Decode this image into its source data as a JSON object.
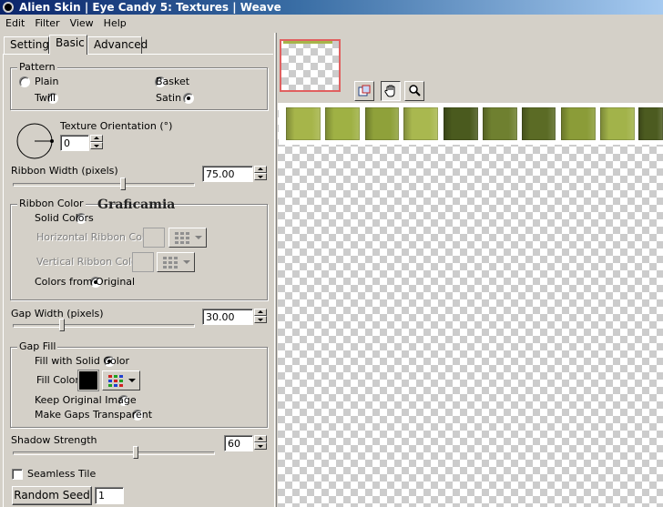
{
  "window": {
    "title": "Alien Skin | Eye Candy 5: Textures | Weave"
  },
  "menu": [
    "Edit",
    "Filter",
    "View",
    "Help"
  ],
  "tabs": [
    "Settings",
    "Basic",
    "Advanced"
  ],
  "active_tab": "Basic",
  "pattern": {
    "title": "Pattern",
    "options": [
      "Plain",
      "Basket",
      "Twill",
      "Satin"
    ],
    "selected": "Satin"
  },
  "texture_orientation": {
    "label": "Texture Orientation (°)",
    "value": "0"
  },
  "ribbon_width": {
    "label": "Ribbon Width (pixels)",
    "value": "75.00",
    "slider_fraction": 0.6
  },
  "ribbon_color": {
    "title": "Ribbon Color",
    "solid_colors": "Solid Colors",
    "horizontal_label": "Horizontal Ribbon Color",
    "vertical_label": "Vertical Ribbon Color",
    "from_original": "Colors from Original",
    "selected": "Colors from Original"
  },
  "watermark": "Graficamia",
  "gap_width": {
    "label": "Gap Width (pixels)",
    "value": "30.00",
    "slider_fraction": 0.27
  },
  "gap_fill": {
    "title": "Gap Fill",
    "fill_solid": "Fill with Solid Color",
    "fill_color_label": "Fill Color",
    "fill_color": "#000000",
    "keep_original": "Keep Original Image",
    "transparent": "Make Gaps Transparent",
    "selected": "Fill with Solid Color"
  },
  "shadow_strength": {
    "label": "Shadow Strength",
    "value": "60",
    "slider_fraction": 0.6
  },
  "seamless_tile": {
    "label": "Seamless Tile",
    "checked": false
  },
  "random_seed": {
    "button": "Random Seed",
    "value": "1"
  },
  "preview": {
    "tools": [
      "navigator-icon",
      "hand-icon",
      "zoom-icon"
    ],
    "tile_colors": [
      "#a6b54a",
      "#9fb144",
      "#8fa13a",
      "#a9b84f",
      "#4a5a1e",
      "#6f8030",
      "#5b6b25",
      "#8b9c38",
      "#a2b34a",
      "#4c5b20"
    ]
  }
}
